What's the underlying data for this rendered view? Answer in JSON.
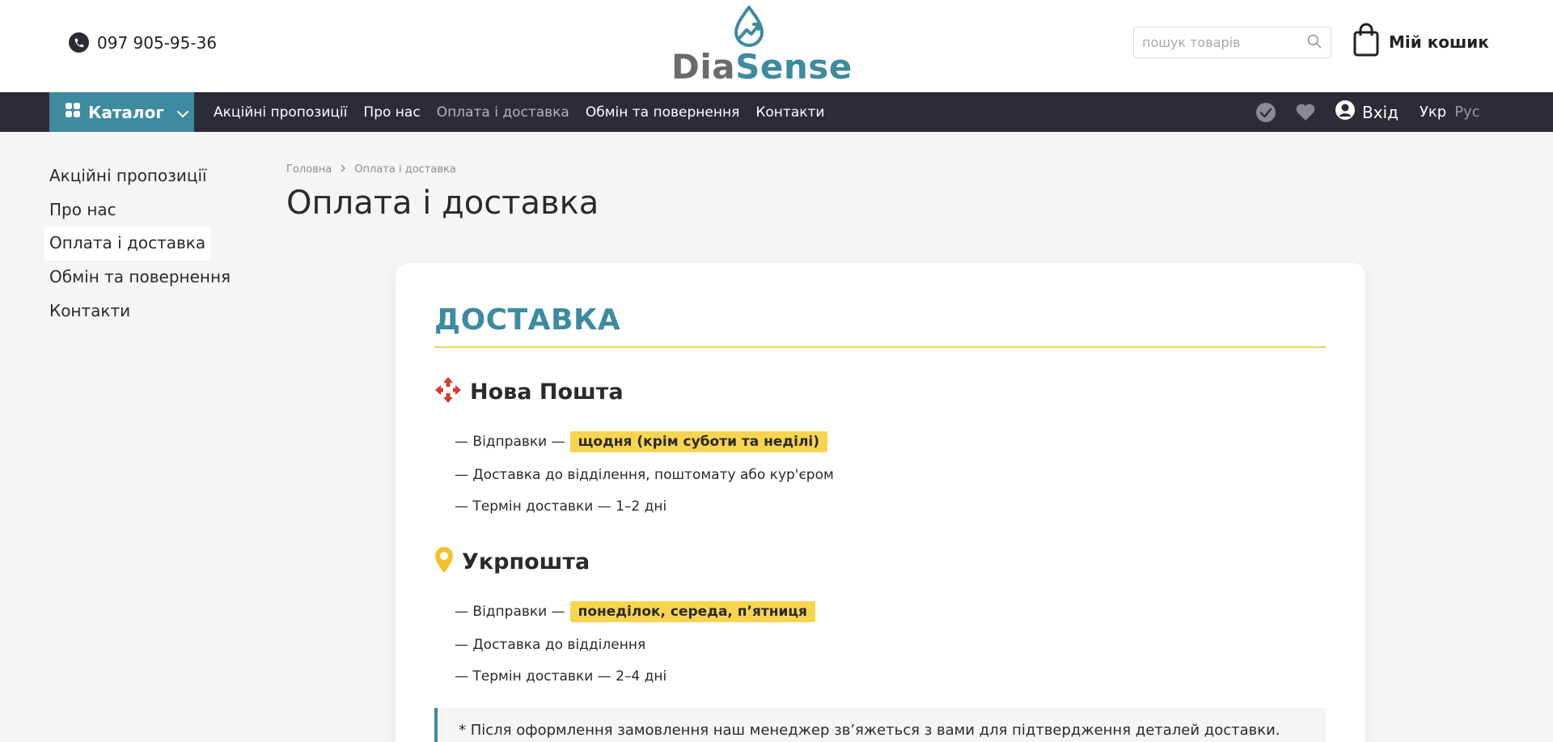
{
  "header": {
    "phone": "097 905-95-36",
    "logo": {
      "part1": "Dia",
      "part2": "Sense"
    },
    "search_placeholder": "пошук товарів",
    "cart_label": "Мій кошик"
  },
  "nav": {
    "catalog_label": "Каталог",
    "links": [
      {
        "label": "Акційні пропозиції"
      },
      {
        "label": "Про нас"
      },
      {
        "label": "Оплата і доставка"
      },
      {
        "label": "Обмін та повернення"
      },
      {
        "label": "Контакти"
      }
    ],
    "login_label": "Вхід",
    "lang_active": "Укр",
    "lang_inactive": "Рус"
  },
  "sidebar": {
    "items": [
      {
        "label": "Акційні пропозиції"
      },
      {
        "label": "Про нас"
      },
      {
        "label": "Оплата і доставка"
      },
      {
        "label": "Обмін та повернення"
      },
      {
        "label": "Контакти"
      }
    ]
  },
  "breadcrumb": {
    "home": "Головна",
    "current": "Оплата і доставка"
  },
  "page_title": "Оплата і доставка",
  "delivery": {
    "title": "ДОСТАВКА",
    "nova_poshta": {
      "name": "Нова Пошта",
      "line1_prefix": "— Відправки —",
      "line1_highlight": "щодня (крім суботи та неділі)",
      "line2": "— Доставка до відділення, поштомату або кур'єром",
      "line3": "— Термін доставки — 1–2 дні"
    },
    "ukrposhta": {
      "name": "Укрпошта",
      "line1_prefix": "— Відправки —",
      "line1_highlight": "понеділок, середа, п’ятниця",
      "line2": "— Доставка до відділення",
      "line3": "— Термін доставки — 2–4 дні"
    },
    "note": "* Після оформлення замовлення наш менеджер зв’яжеться з вами для підтвердження деталей доставки."
  },
  "colors": {
    "accent": "#3e8aa0",
    "nav_bg": "#2b2c36",
    "highlight": "#f9d54f",
    "nova_poshta_red": "#d63a2f",
    "ukrposhta_yellow": "#f2c12e"
  }
}
